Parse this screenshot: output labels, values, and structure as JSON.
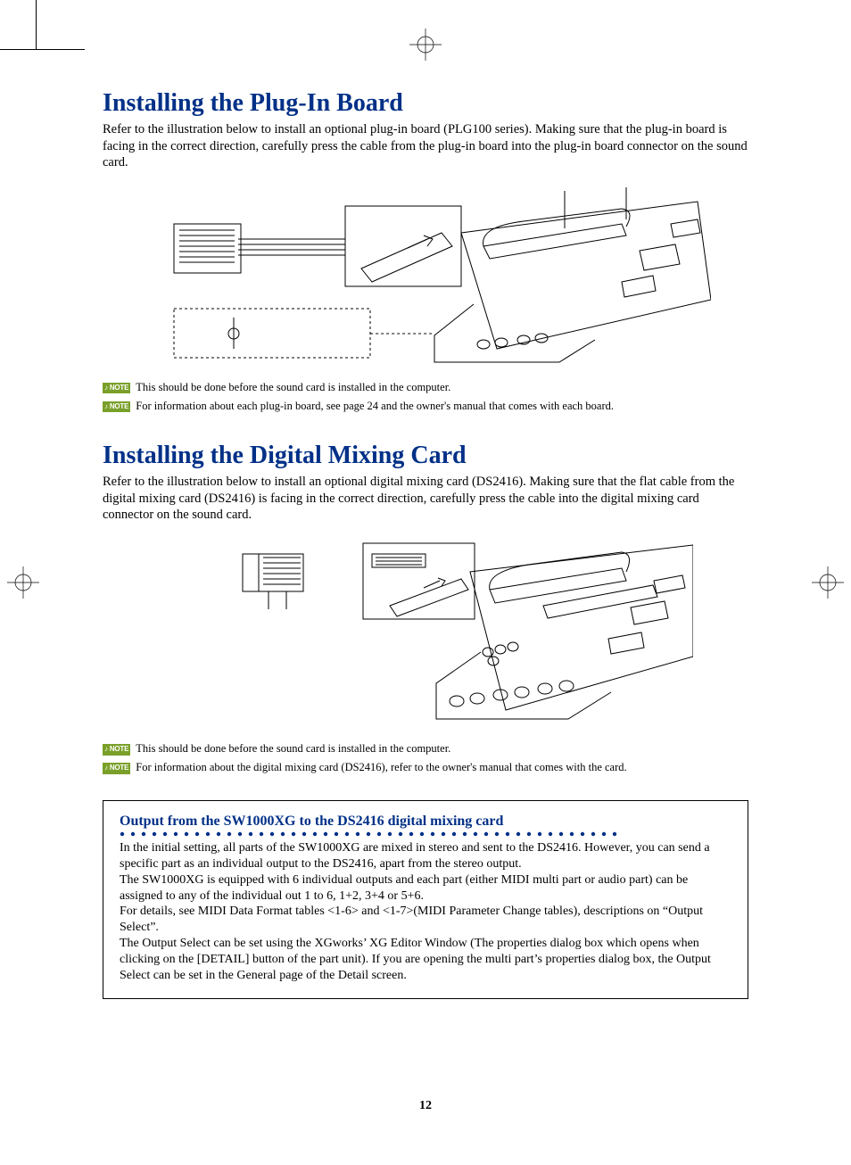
{
  "section1": {
    "heading": "Installing the Plug-In Board",
    "para": "Refer to the illustration below to install an optional plug-in board (PLG100 series). Making sure that the plug-in board is facing in the correct direction, carefully press the cable from the plug-in board into the plug-in board connector on the sound card.",
    "note_badge": "♪ NOTE",
    "note1": "This should be done before the sound card is installed in the computer.",
    "note2": "For information about each plug-in board, see page 24 and the owner's manual that comes with each board."
  },
  "section2": {
    "heading": "Installing the Digital Mixing Card",
    "para": "Refer to the illustration below to install an optional digital mixing card (DS2416). Making sure that the flat cable from the digital mixing card (DS2416) is facing in the correct direction, carefully press the cable into the digital mixing card connector on the sound card.",
    "note_badge": "♪ NOTE",
    "note1": "This should be done before the sound card is installed in the computer.",
    "note2": "For information about the digital mixing card (DS2416), refer to the owner's manual that comes with the card."
  },
  "infobox": {
    "title": "Output from the SW1000XG to the DS2416 digital mixing card",
    "body": "In the initial setting, all parts of the SW1000XG are mixed in stereo and sent to the DS2416. However, you can send a specific part as an individual output to the DS2416, apart from the stereo output.\nThe SW1000XG is equipped with 6 individual outputs and each part (either MIDI multi part or audio part) can be assigned to any of the individual out 1 to 6, 1+2, 3+4 or 5+6.\nFor details, see MIDI Data Format tables <1-6> and <1-7>(MIDI Parameter Change tables), descriptions on “Output Select”.\nThe Output Select can be set using the XGworks’ XG Editor Window (The properties dialog box which opens when clicking on the [DETAIL] button of the part unit). If you are opening the multi part’s properties dialog box, the Output Select can be set in the General page of the Detail screen."
  },
  "page_number": "12"
}
